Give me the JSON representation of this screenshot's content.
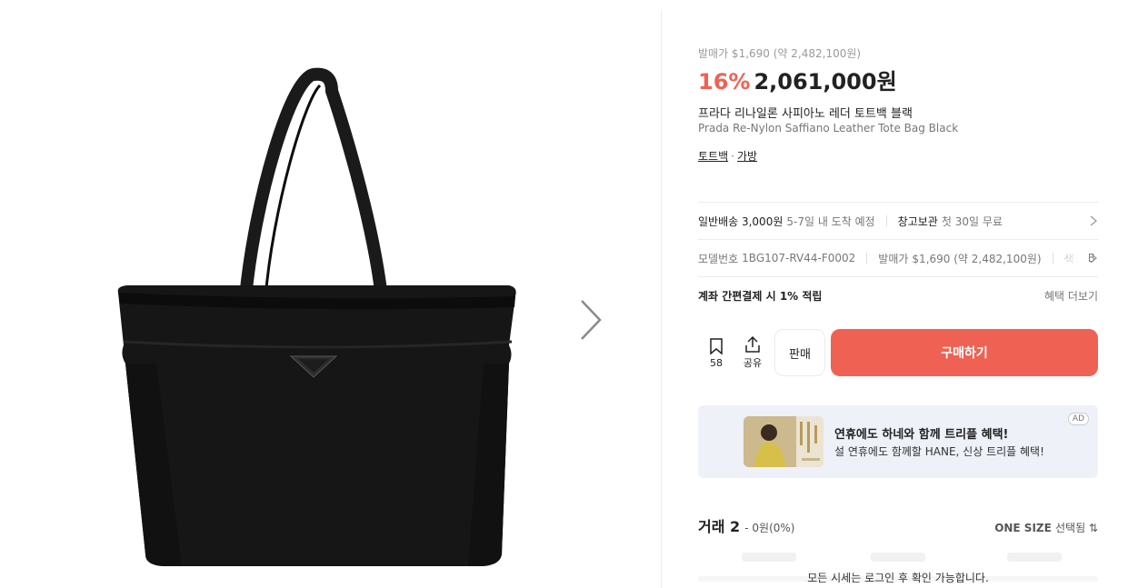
{
  "gallery": {
    "image_alt": "Prada Re-Nylon Saffiano Leather Tote Bag Black"
  },
  "product": {
    "release_price": "발매가 $1,690 (약 2,482,100원)",
    "discount": "16%",
    "price": "2,061,000원",
    "name_ko": "프라다 리나일론 사피아노 레더 토트백 블랙",
    "name_en": "Prada Re-Nylon Saffiano Leather Tote Bag Black",
    "categories": [
      "토트백",
      "가방"
    ]
  },
  "delivery": {
    "shipping_key": "일반배송 3,000원",
    "shipping_val": "5-7일 내 도착 예정",
    "storage_key": "창고보관",
    "storage_val": "첫 30일 무료"
  },
  "specs": {
    "model_key": "모델번호",
    "model_val": "1BG107-RV44-F0002",
    "release_key": "발매가",
    "release_val": "$1,690 (약 2,482,100원)",
    "color_key": "색상",
    "color_val": "B"
  },
  "benefit": {
    "title": "계좌 간편결제 시 1% 적립",
    "more": "혜택 더보기"
  },
  "actions": {
    "bookmark_count": "58",
    "share_label": "공유",
    "sell_label": "판매",
    "buy_label": "구매하기"
  },
  "ad": {
    "title": "연휴에도 하네와 함께 트리플 혜택!",
    "subtitle": "설 연휴에도 함께할 HANE, 신상 트리플 혜택!",
    "badge": "AD"
  },
  "trade": {
    "title": "거래 2",
    "count": "- 0원(0%)",
    "size": "ONE SIZE",
    "size_suffix": "선택됨 ⇅",
    "login_note": "모든 시세는 로그인 후 확인 가능합니다."
  },
  "colors": {
    "accent": "#ef6253",
    "muted": "#777777",
    "ad_bg": "#eef1f8"
  }
}
